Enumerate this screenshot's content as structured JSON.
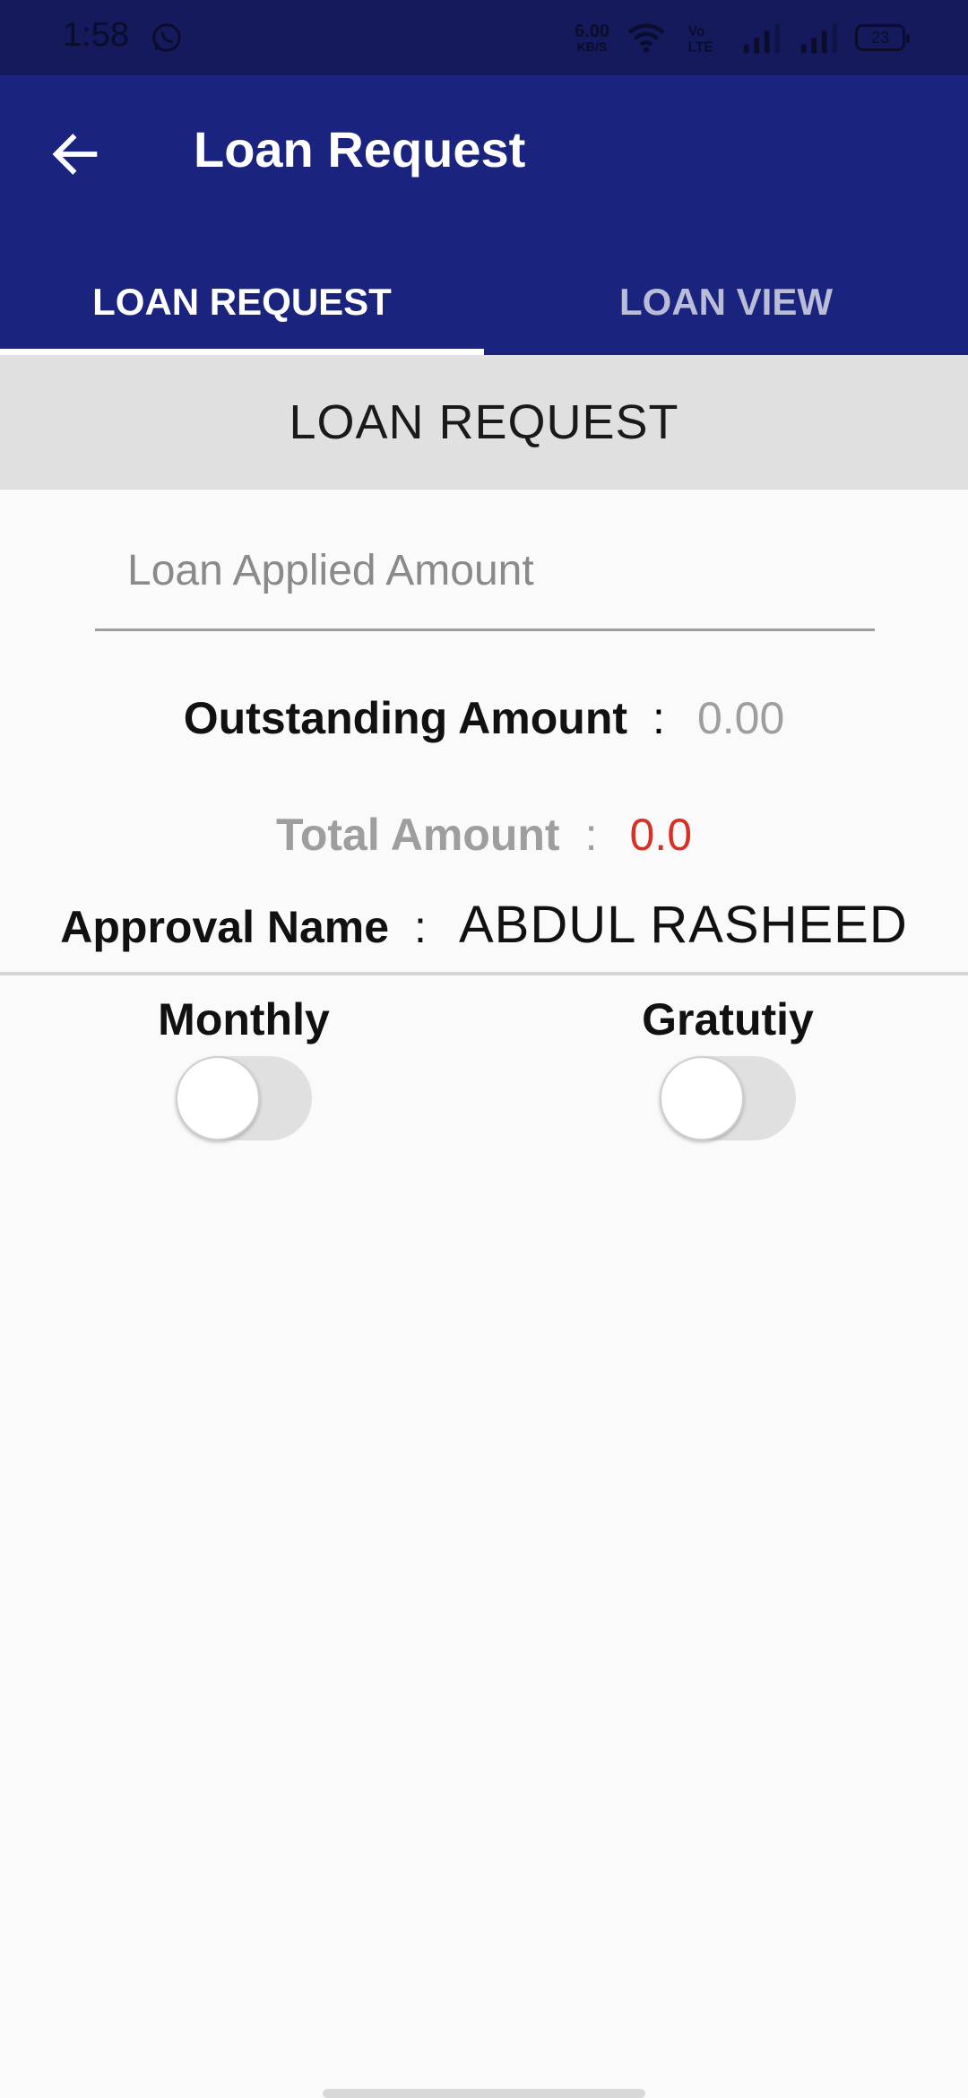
{
  "status_bar": {
    "time": "1:58",
    "speed_value": "6.00",
    "speed_unit": "KB/S",
    "battery": "23",
    "icons": [
      "whatsapp-icon",
      "wifi-icon",
      "volte-icon",
      "signal-icon",
      "signal-icon",
      "battery-icon"
    ]
  },
  "app_bar": {
    "title": "Loan Request",
    "back_icon": "arrow-left-icon",
    "background": "#1a237e"
  },
  "tabs": [
    {
      "label": "LOAN REQUEST",
      "active": true
    },
    {
      "label": "LOAN VIEW",
      "active": false
    }
  ],
  "section": {
    "title": "LOAN REQUEST"
  },
  "form": {
    "amount_placeholder": "Loan Applied Amount",
    "amount_value": "",
    "outstanding_label": "Outstanding Amount",
    "outstanding_value": "0.00",
    "total_label": "Total Amount",
    "total_value": "0.0",
    "approval_label": "Approval Name",
    "approval_value": "ABDUL RASHEED",
    "separator": ":"
  },
  "toggles": {
    "monthly_label": "Monthly",
    "monthly_on": false,
    "gratuity_label": "Gratutiy",
    "gratuity_on": false
  },
  "colors": {
    "accent": "#1a237e",
    "total_value": "#d93025",
    "muted": "#9e9e9e"
  }
}
